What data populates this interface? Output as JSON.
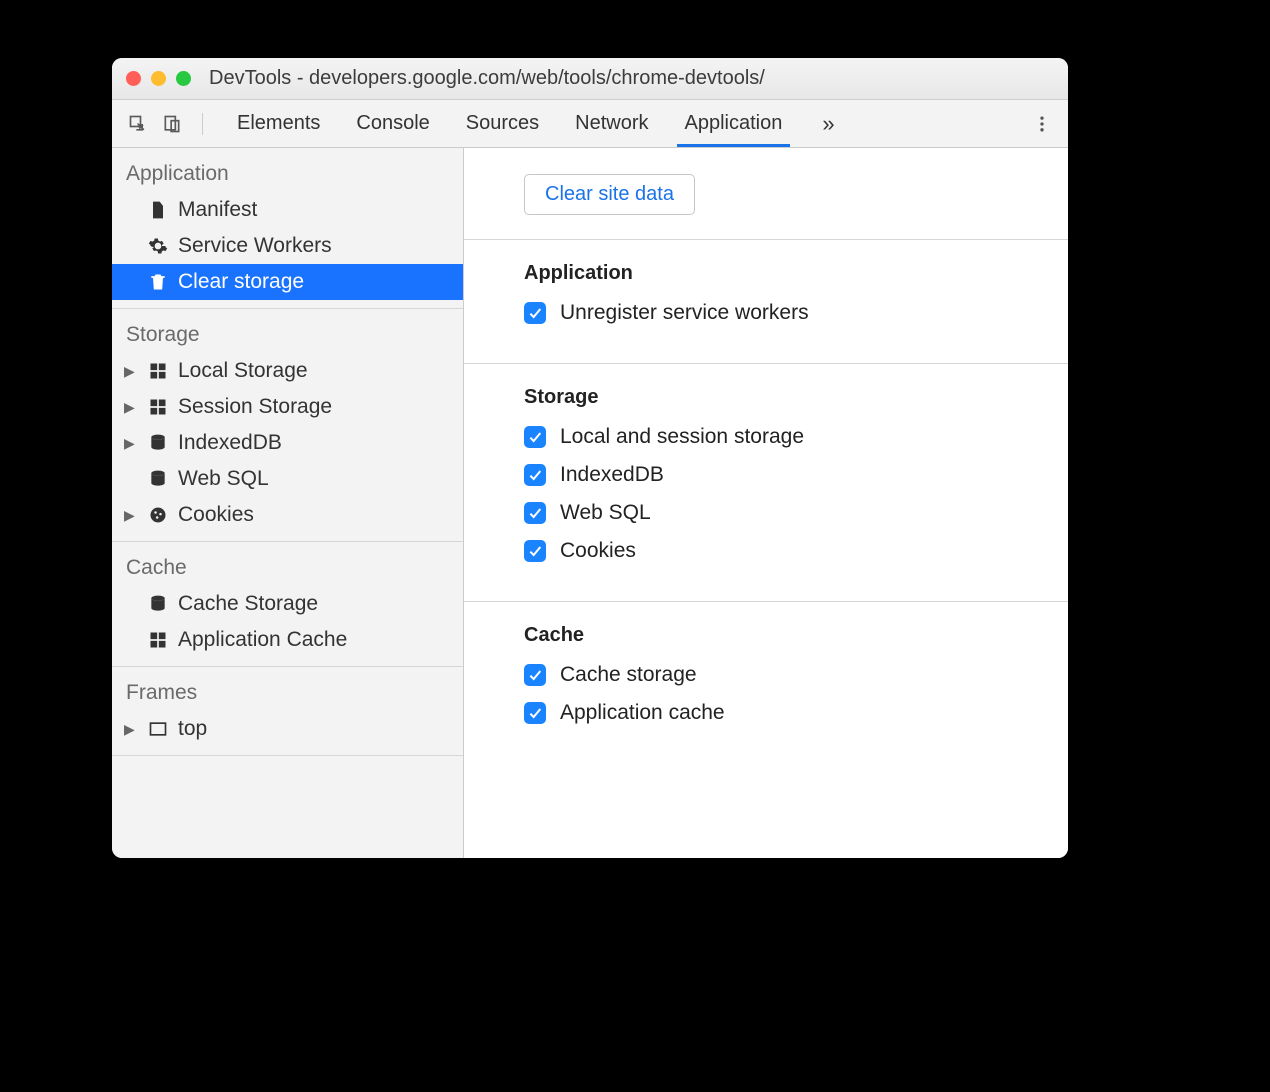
{
  "window": {
    "title": "DevTools - developers.google.com/web/tools/chrome-devtools/"
  },
  "toolbar": {
    "tabs": [
      "Elements",
      "Console",
      "Sources",
      "Network",
      "Application"
    ],
    "active_tab": "Application"
  },
  "sidebar": {
    "sections": [
      {
        "title": "Application",
        "items": [
          {
            "label": "Manifest",
            "icon": "file",
            "expandable": false
          },
          {
            "label": "Service Workers",
            "icon": "gear",
            "expandable": false
          },
          {
            "label": "Clear storage",
            "icon": "trash",
            "expandable": false,
            "selected": true
          }
        ]
      },
      {
        "title": "Storage",
        "items": [
          {
            "label": "Local Storage",
            "icon": "grid",
            "expandable": true
          },
          {
            "label": "Session Storage",
            "icon": "grid",
            "expandable": true
          },
          {
            "label": "IndexedDB",
            "icon": "db",
            "expandable": true
          },
          {
            "label": "Web SQL",
            "icon": "db",
            "expandable": false
          },
          {
            "label": "Cookies",
            "icon": "cookie",
            "expandable": true
          }
        ]
      },
      {
        "title": "Cache",
        "items": [
          {
            "label": "Cache Storage",
            "icon": "db",
            "expandable": false
          },
          {
            "label": "Application Cache",
            "icon": "grid",
            "expandable": false
          }
        ]
      },
      {
        "title": "Frames",
        "items": [
          {
            "label": "top",
            "icon": "frame",
            "expandable": true
          }
        ]
      }
    ]
  },
  "main": {
    "clear_button": "Clear site data",
    "sections": [
      {
        "title": "Application",
        "options": [
          {
            "label": "Unregister service workers",
            "checked": true
          }
        ]
      },
      {
        "title": "Storage",
        "options": [
          {
            "label": "Local and session storage",
            "checked": true
          },
          {
            "label": "IndexedDB",
            "checked": true
          },
          {
            "label": "Web SQL",
            "checked": true
          },
          {
            "label": "Cookies",
            "checked": true
          }
        ]
      },
      {
        "title": "Cache",
        "options": [
          {
            "label": "Cache storage",
            "checked": true
          },
          {
            "label": "Application cache",
            "checked": true
          }
        ]
      }
    ]
  }
}
